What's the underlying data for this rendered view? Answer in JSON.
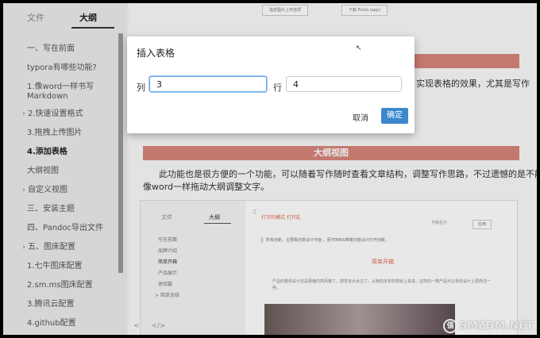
{
  "sidebar": {
    "tabs": [
      {
        "label": "文件"
      },
      {
        "label": "大纲"
      }
    ],
    "outline": [
      {
        "label": "一、写在前面"
      },
      {
        "label": "typora有哪些功能?"
      },
      {
        "label": "1.像word一样书写"
      },
      {
        "label": "Markdown"
      },
      {
        "label": "2.快速设置格式"
      },
      {
        "label": "3.拖拽上传图片"
      },
      {
        "label": "4.添加表格"
      },
      {
        "label": "大纲视图"
      },
      {
        "label": "自定义视图"
      },
      {
        "label": "三、安装主题"
      },
      {
        "label": "四、Pandoc导出文件"
      },
      {
        "label": "五、图床配置"
      },
      {
        "label": "1.七牛图床配置"
      },
      {
        "label": "2.sm.ms图床配置"
      },
      {
        "label": "3.腾讯云配置"
      },
      {
        "label": "4.github配置"
      }
    ],
    "bottom_icons": [
      "<",
      "</>"
    ]
  },
  "main": {
    "top_buttons": [
      "指定图片上传选项",
      "下载 PicGo (app)"
    ],
    "text_right_1": "实现表格的效果，尤其是写作",
    "section_heading": "大纲视图",
    "para_line1": "此功能也是很方便的一个功能，可以随着写作随时查看文章结构，调整写作思路，不过遗憾的是不能",
    "para_line2": "像word一样拖动大纲调整文字。",
    "embed": {
      "tabs": [
        "文件",
        "大纲"
      ],
      "items": [
        "写在前面",
        "品牌介绍",
        "简单开箱",
        "产品展示",
        "体验篇",
        "> 简单总结"
      ],
      "title": "打字的模式  打开乱",
      "quote": "所有创新，主要靠创意设计平面 ，而TENNIS带着创意设计打开创新。",
      "heading": "简单开箱",
      "para": "产品的整体设计还是很偏向简风格了，感觉有点太过了。从我前多年的感受上来说，这样的一数产品可以有些设计上更简洁一些。",
      "checkbox": "平衡显示",
      "button": "应用"
    },
    "watermark": "SMZDM.NET"
  },
  "dialog": {
    "title": "插入表格",
    "col_label": "列",
    "col_value": "3",
    "row_label": "行",
    "row_value": "4",
    "cancel": "取消",
    "ok": "确定"
  },
  "colors": {
    "heading_bar": "#d7857a",
    "ok_button": "#3b87cd",
    "focus": "#67a5e6"
  }
}
